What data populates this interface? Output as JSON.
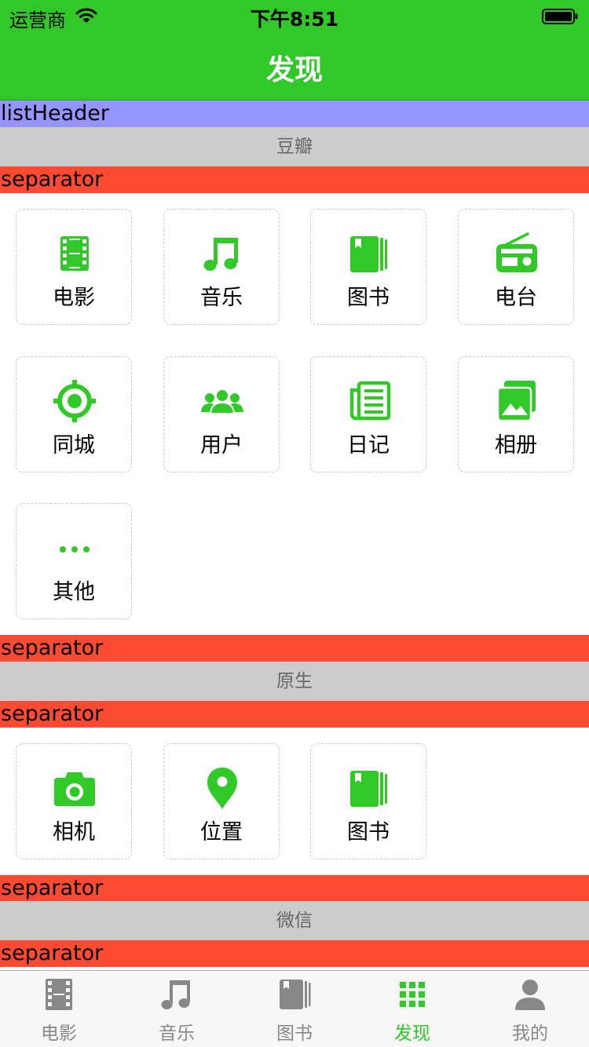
{
  "status_bar": {
    "carrier": "运营商",
    "time": "下午8:51"
  },
  "nav": {
    "title": "发现"
  },
  "list_header": "listHeader",
  "separator_label": "separator",
  "sections": {
    "douban": {
      "title": "豆瓣",
      "items": [
        {
          "label": "电影",
          "icon": "film-icon"
        },
        {
          "label": "音乐",
          "icon": "music-note-icon"
        },
        {
          "label": "图书",
          "icon": "book-icon"
        },
        {
          "label": "电台",
          "icon": "radio-icon"
        },
        {
          "label": "同城",
          "icon": "location-target-icon"
        },
        {
          "label": "用户",
          "icon": "users-icon"
        },
        {
          "label": "日记",
          "icon": "newspaper-icon"
        },
        {
          "label": "相册",
          "icon": "photo-album-icon"
        },
        {
          "label": "其他",
          "icon": "more-dots-icon"
        }
      ]
    },
    "native": {
      "title": "原生",
      "items": [
        {
          "label": "相机",
          "icon": "camera-icon"
        },
        {
          "label": "位置",
          "icon": "map-pin-icon"
        },
        {
          "label": "图书",
          "icon": "book-icon"
        }
      ]
    },
    "wechat": {
      "title": "微信"
    }
  },
  "tabs": [
    {
      "label": "电影",
      "icon": "film-icon",
      "active": false
    },
    {
      "label": "音乐",
      "icon": "music-note-icon",
      "active": false
    },
    {
      "label": "图书",
      "icon": "book-icon",
      "active": false
    },
    {
      "label": "发现",
      "icon": "grid-icon",
      "active": true
    },
    {
      "label": "我的",
      "icon": "person-icon",
      "active": false
    }
  ],
  "colors": {
    "accent": "#31c927",
    "header_band": "#9695fe",
    "separator_band": "#fd4a33",
    "section_header": "#cccccc",
    "tab_inactive": "#888888"
  }
}
